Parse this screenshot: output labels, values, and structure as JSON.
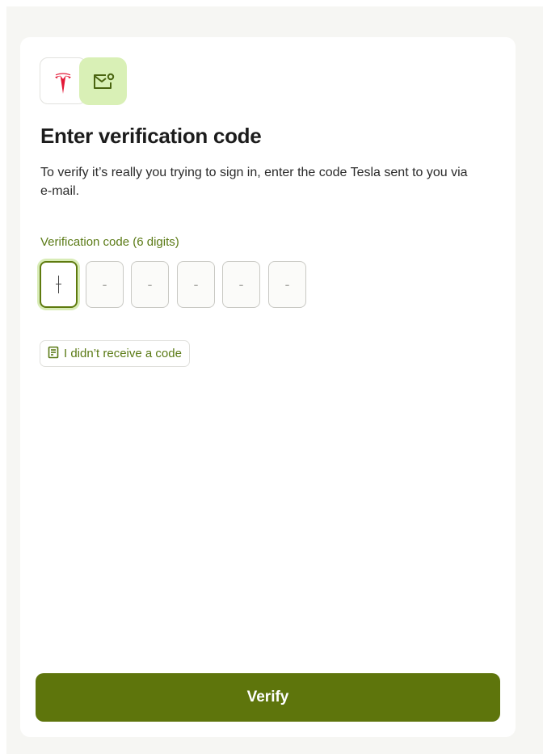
{
  "header": {
    "brand_logo": "tesla-logo",
    "badge_icon": "mail-icon"
  },
  "main": {
    "title": "Enter verification code",
    "description": "To verify it’s really you trying to sign in, enter the code Tesla sent to you via e-mail.",
    "code_label": "Verification code (6 digits)",
    "code_placeholder": "-",
    "code_length": 6,
    "active_index": 0,
    "no_code_label": "I didn’t receive a code",
    "no_code_icon": "document-icon"
  },
  "footer": {
    "verify_label": "Verify"
  },
  "colors": {
    "accent": "#5e750c",
    "accent_light": "#d9f0b6",
    "tesla_red": "#e31937",
    "label_green": "#5a7a15"
  }
}
